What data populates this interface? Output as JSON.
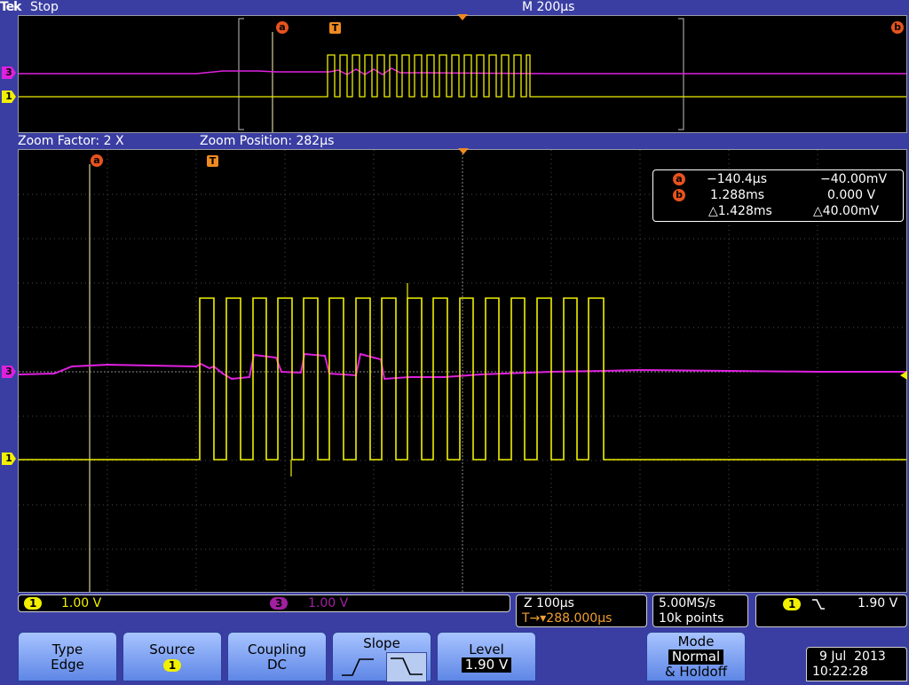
{
  "header": {
    "brand": "Tek",
    "run_state": "Stop",
    "timebase": "M 200µs"
  },
  "zoom": {
    "factor": "Zoom Factor: 2 X",
    "position": "Zoom Position: 282µs"
  },
  "markers": {
    "cursor_a": "a",
    "cursor_b": "b",
    "trigger": "T"
  },
  "channels": {
    "ch1": {
      "tag": "1",
      "color": "#f0f000"
    },
    "ch3": {
      "tag": "3",
      "color": "#e020e0"
    }
  },
  "cursor_readout": {
    "a_time": "−140.4µs",
    "a_volt": "−40.00mV",
    "b_time": "1.288ms",
    "b_volt": "0.000 V",
    "delta_time": "△1.428ms",
    "delta_volt": "△40.00mV"
  },
  "status": {
    "ch1_tag": "1",
    "ch1_scale": "1.00 V",
    "ch3_tag": "3",
    "ch3_scale": "1.00 V",
    "zoom_scale": "Z 100µs",
    "trigger_pos": "T→▾288.000µs",
    "sample_rate": "5.00MS/s",
    "record_length": "10k points",
    "trig_ch": "1",
    "trig_slope_icon": "falling-edge-icon",
    "trig_level": "1.90 V"
  },
  "menu": {
    "type_label": "Type",
    "type_value": "Edge",
    "source_label": "Source",
    "source_value": "1",
    "coupling_label": "Coupling",
    "coupling_value": "DC",
    "slope_label": "Slope",
    "level_label": "Level",
    "level_value": "1.90 V",
    "mode_label": "Mode",
    "mode_value": "Normal",
    "mode_sub": "& Holdoff"
  },
  "datetime": {
    "date": "9 Jul  2013",
    "time": "10:22:28"
  }
}
